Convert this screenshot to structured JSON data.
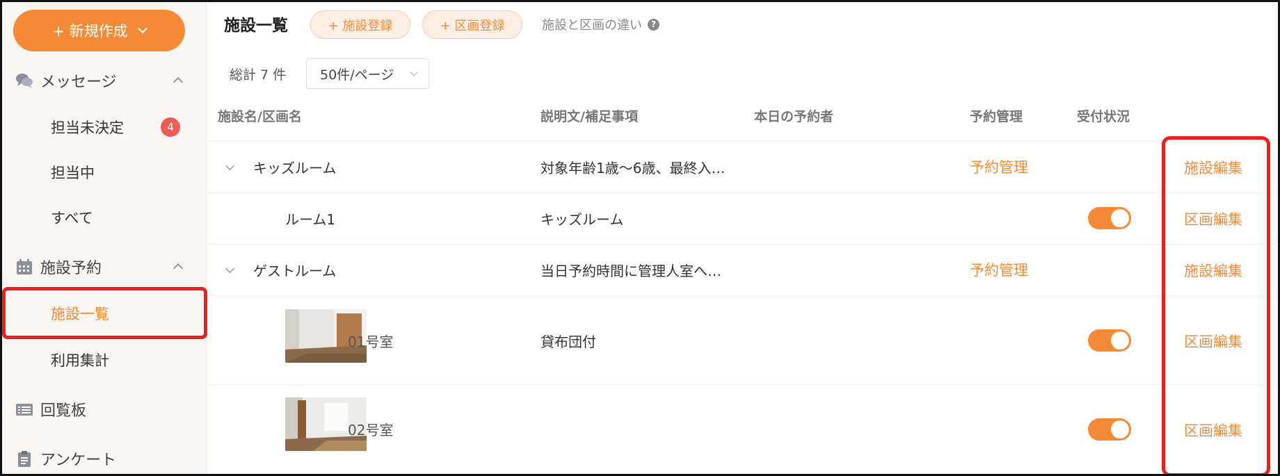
{
  "sidebar": {
    "new_button_label": "+ 新規作成",
    "messages": {
      "label": "メッセージ",
      "items": [
        {
          "label": "担当未決定",
          "badge": "4"
        },
        {
          "label": "担当中"
        },
        {
          "label": "すべて"
        }
      ]
    },
    "facility": {
      "label": "施設予約",
      "items": [
        {
          "label": "施設一覧",
          "active": true
        },
        {
          "label": "利用集計"
        }
      ]
    },
    "bulletin": {
      "label": "回覧板"
    },
    "survey": {
      "label": "アンケート"
    }
  },
  "main": {
    "title": "施設一覧",
    "add_facility_label": "+ 施設登録",
    "add_section_label": "+ 区画登録",
    "help_link_label": "施設と区画の違い",
    "total_label": "総計 7 件",
    "per_page_value": "50件/ページ",
    "columns": [
      "施設名/区画名",
      "説明文/補足事項",
      "本日の予約者",
      "予約管理",
      "受付状況"
    ],
    "rows": [
      {
        "name": "キッズルーム",
        "description": "対象年齢1歳〜6歳、最終入…",
        "manage": "予約管理",
        "action": "施設編集"
      },
      {
        "name": "ルーム1",
        "description": "キッズルーム",
        "action": "区画編集",
        "accepting": true
      },
      {
        "name": "ゲストルーム",
        "description": "当日予約時間に管理人室へ…",
        "manage": "予約管理",
        "action": "施設編集"
      },
      {
        "name": "01号室",
        "description": "貸布団付",
        "action": "区画編集",
        "accepting": true
      },
      {
        "name": "02号室",
        "description": "",
        "action": "区画編集",
        "accepting": true
      }
    ]
  },
  "colors": {
    "accent": "#f48a35",
    "highlight": "#e8201e",
    "badge": "#ef5b57"
  }
}
